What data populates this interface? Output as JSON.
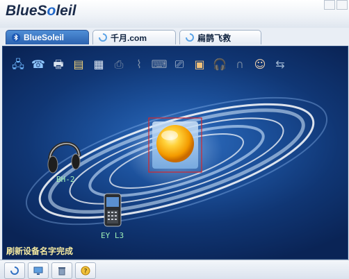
{
  "app": {
    "logo_text_pre": "BlueS",
    "logo_text_o": "o",
    "logo_text_post": "leil"
  },
  "tabs": [
    {
      "label": "BlueSoleil",
      "active": true
    },
    {
      "label": "千月.com",
      "active": false
    },
    {
      "label": "扁鹊飞救",
      "active": false
    }
  ],
  "toolbar": [
    {
      "icon": "network-icon"
    },
    {
      "icon": "dialup-icon"
    },
    {
      "icon": "printer-icon"
    },
    {
      "icon": "file-transfer-icon"
    },
    {
      "icon": "contacts-icon"
    },
    {
      "icon": "fax-icon"
    },
    {
      "icon": "serial-icon"
    },
    {
      "icon": "keyboard-icon"
    },
    {
      "icon": "fax-machine-icon"
    },
    {
      "icon": "image-icon"
    },
    {
      "icon": "headphones-icon"
    },
    {
      "icon": "headset-icon"
    },
    {
      "icon": "person-icon"
    },
    {
      "icon": "sync-icon"
    }
  ],
  "devices": {
    "headphone_label": "BH-2",
    "phone_label": "EY L3"
  },
  "status_text": "刷新设备名字完成",
  "colors": {
    "stage_dark": "#0a2456",
    "stage_light": "#2f6fc2",
    "status_text": "#f4e9a0",
    "device_label": "#9ff0b6",
    "orb": "#ffb000"
  }
}
